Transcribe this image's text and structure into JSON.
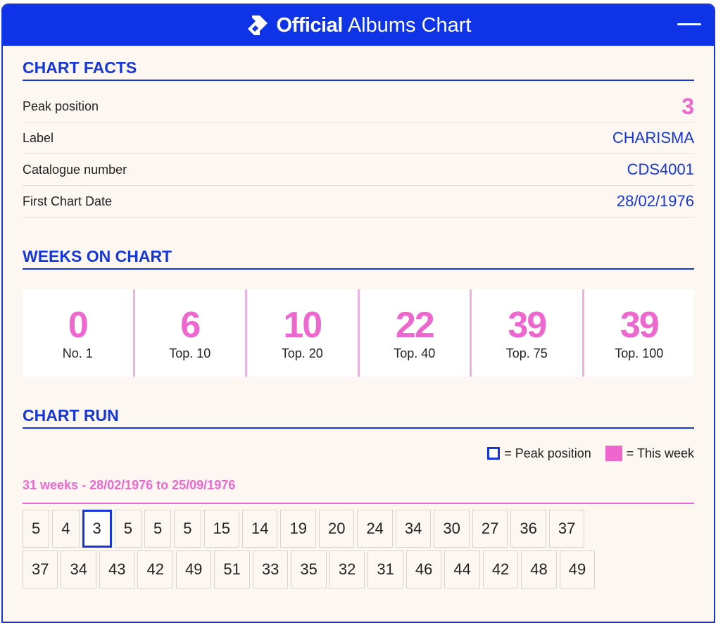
{
  "header": {
    "brand_bold": "Official",
    "brand_light": "Albums Chart"
  },
  "facts": {
    "title": "CHART FACTS",
    "rows": [
      {
        "label": "Peak position",
        "value": "3"
      },
      {
        "label": "Label",
        "value": "CHARISMA"
      },
      {
        "label": "Catalogue number",
        "value": "CDS4001"
      },
      {
        "label": "First Chart Date",
        "value": "28/02/1976"
      }
    ]
  },
  "weeks": {
    "title": "WEEKS ON CHART",
    "stats": [
      {
        "value": "0",
        "label": "No. 1"
      },
      {
        "value": "6",
        "label": "Top. 10"
      },
      {
        "value": "10",
        "label": "Top. 20"
      },
      {
        "value": "22",
        "label": "Top. 40"
      },
      {
        "value": "39",
        "label": "Top. 75"
      },
      {
        "value": "39",
        "label": "Top. 100"
      }
    ]
  },
  "run": {
    "title": "CHART RUN",
    "legend_peak": "= Peak position",
    "legend_this": "= This week",
    "range": "31 weeks - 28/02/1976 to 25/09/1976",
    "row1": [
      "5",
      "4",
      "3",
      "5",
      "5",
      "5",
      "15",
      "14",
      "19",
      "20",
      "24",
      "34",
      "30",
      "27",
      "36",
      "37"
    ],
    "row2": [
      "37",
      "34",
      "43",
      "42",
      "49",
      "51",
      "33",
      "35",
      "32",
      "31",
      "46",
      "44",
      "42",
      "48",
      "49"
    ]
  },
  "colors": {
    "brand_blue": "#1536d8",
    "pink": "#ee67cf"
  }
}
